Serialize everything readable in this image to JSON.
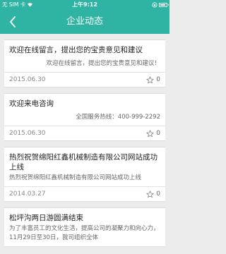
{
  "status_bar": {
    "carrier": "无 SIM 卡",
    "time": "上午9:12"
  },
  "nav": {
    "title": "企业动态"
  },
  "articles": [
    {
      "title": "欢迎在线留言，提出您的宝贵意见和建议",
      "desc": "欢迎在线留言，提出您的宝贵意见和建议！",
      "date": "2015.06.30",
      "fav_count": "0"
    },
    {
      "title": "欢迎来电咨询",
      "desc": "全国服务热线：400-999-2292",
      "date": "2015.06.30",
      "fav_count": "0"
    },
    {
      "title": "热烈祝贺绵阳红鑫机械制造有限公司网站成功上线",
      "desc": "热烈祝贺绵阳红鑫机械制造有限公司网站成功上线",
      "date": "2014.03.27",
      "fav_count": "0"
    },
    {
      "title": "松坪沟两日游圆满结束",
      "desc": "为了丰富员工的文化生活，提高公司的凝聚力和向心力，11月29日至30日，我司组织全体",
      "date": "",
      "fav_count": ""
    }
  ],
  "colors": {
    "header": "#2fb3a3"
  }
}
